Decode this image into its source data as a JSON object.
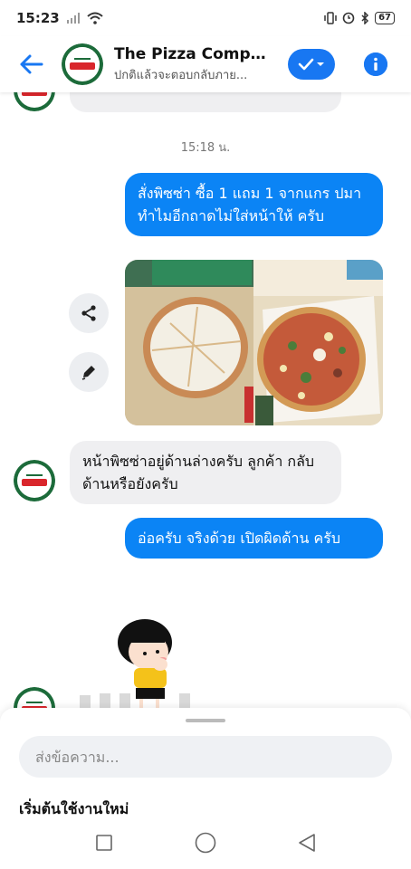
{
  "status_bar": {
    "time": "15:23",
    "battery": "67"
  },
  "header": {
    "title": "The Pizza Comp...",
    "subtitle": "ปกติแล้วจะตอบกลับภาย..."
  },
  "chat": {
    "timestamp": "15:18 น.",
    "messages": [
      {
        "sender": "me",
        "text": "สั่งพิซซ่า ซื้อ 1 แถม 1  จากแกร ปมา ทำไมอีกถาดไม่ใส่หน้าให้ ครับ"
      },
      {
        "sender": "me",
        "type": "photo",
        "content": "two pizza boxes: one upside-down plain crust, one topped pizza"
      },
      {
        "sender": "page",
        "text": "หน้าพิซซ่าอยู่ด้านล่างครับ ลูกค้า กลับด้านหรือยังครับ"
      },
      {
        "sender": "me",
        "text": "อ่อครับ จริงด้วย เปิดผิดด้าน ครับ"
      },
      {
        "sender": "page",
        "type": "sticker",
        "content": "girl character sticker"
      }
    ]
  },
  "composer": {
    "placeholder": "ส่งข้อความ...",
    "new_start": "เริ่มต้นใช้งานใหม่"
  },
  "icons": {
    "back": "arrow-left-icon",
    "check": "check-icon",
    "info": "info-icon",
    "share": "share-icon",
    "edit": "pencil-icon"
  },
  "colors": {
    "accent": "#1877f2",
    "outgoing_bubble": "#0b84f5",
    "incoming_bubble": "#efeff1"
  }
}
